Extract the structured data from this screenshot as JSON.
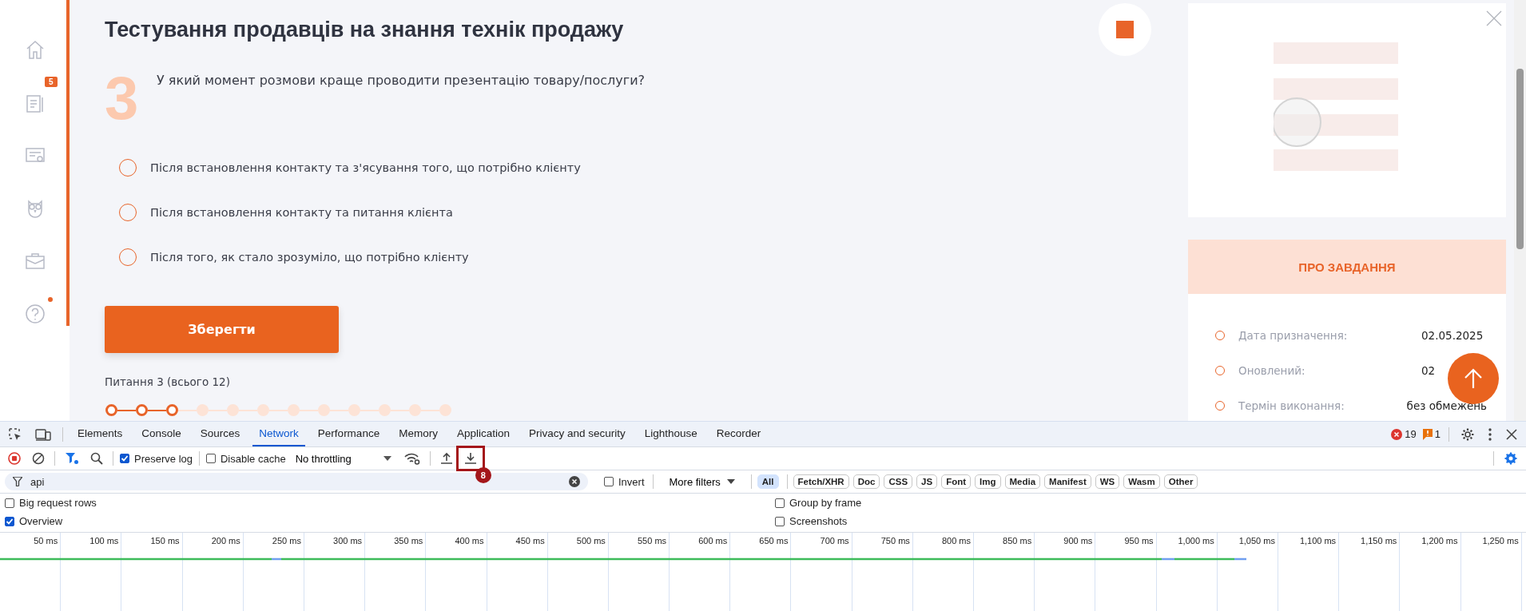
{
  "sidebar": {
    "items": [
      {
        "kind": "home"
      },
      {
        "kind": "document",
        "badge": "5"
      },
      {
        "kind": "certificate"
      },
      {
        "kind": "owl"
      },
      {
        "kind": "briefcase"
      },
      {
        "kind": "help",
        "dot": true
      }
    ]
  },
  "test": {
    "title": "Тестування продавців на знання технік продажу",
    "question_number": "3",
    "question": "У який момент розмови краще проводити презентацію товару/послуги?",
    "options": [
      {
        "text": "Після встановлення контакту та з'ясування того, що потрібно клієнту",
        "selected": false
      },
      {
        "text": "Після встановлення контакту та питання клієнта",
        "selected": false
      },
      {
        "text": "Після того, як стало зрозуміло, що потрібно клієнту",
        "selected": false
      }
    ],
    "save_button": "Зберегти",
    "progress_text": "Питання 3 (всього 12)",
    "progress_steps": [
      {
        "done": true
      },
      {
        "done": true
      },
      {
        "done": true
      },
      {
        "done": false
      },
      {
        "done": false
      },
      {
        "done": false
      },
      {
        "done": false
      },
      {
        "done": false
      },
      {
        "done": false
      },
      {
        "done": false
      },
      {
        "done": false
      },
      {
        "done": false
      }
    ]
  },
  "task_panel": {
    "header": "ПРО ЗАВДАННЯ",
    "details": [
      {
        "label": "Дата призначення:",
        "value": "02.05.2025"
      },
      {
        "label": "Оновлений:",
        "value": "02"
      },
      {
        "label": "Термін виконання:",
        "value": "без обмежень"
      }
    ]
  },
  "devtools": {
    "tabs": [
      {
        "label": "Elements",
        "selected": false
      },
      {
        "label": "Console",
        "selected": false
      },
      {
        "label": "Sources",
        "selected": false
      },
      {
        "label": "Network",
        "selected": true
      },
      {
        "label": "Performance",
        "selected": false
      },
      {
        "label": "Memory",
        "selected": false
      },
      {
        "label": "Application",
        "selected": false
      },
      {
        "label": "Privacy and security",
        "selected": false
      },
      {
        "label": "Lighthouse",
        "selected": false
      },
      {
        "label": "Recorder",
        "selected": false
      }
    ],
    "errors": "19",
    "warnings": "1",
    "toolbar": {
      "preserve_log": {
        "label": "Preserve log",
        "checked": true
      },
      "disable_cache": {
        "label": "Disable cache",
        "checked": false
      },
      "throttling": "No throttling",
      "annotation": "8"
    },
    "filter": {
      "value": "api",
      "invert": {
        "label": "Invert",
        "checked": false
      },
      "more_filters": "More filters",
      "types": [
        {
          "label": "All",
          "selected": true
        },
        {
          "label": "Fetch/XHR",
          "selected": false
        },
        {
          "label": "Doc",
          "selected": false
        },
        {
          "label": "CSS",
          "selected": false
        },
        {
          "label": "JS",
          "selected": false
        },
        {
          "label": "Font",
          "selected": false
        },
        {
          "label": "Img",
          "selected": false
        },
        {
          "label": "Media",
          "selected": false
        },
        {
          "label": "Manifest",
          "selected": false
        },
        {
          "label": "WS",
          "selected": false
        },
        {
          "label": "Wasm",
          "selected": false
        },
        {
          "label": "Other",
          "selected": false
        }
      ]
    },
    "options": [
      {
        "label": "Big request rows",
        "checked": false
      },
      {
        "label": "Group by frame",
        "checked": false
      },
      {
        "label": "Overview",
        "checked": true
      },
      {
        "label": "Screenshots",
        "checked": false
      }
    ],
    "timeline": {
      "ticks": [
        "50 ms",
        "100 ms",
        "150 ms",
        "200 ms",
        "250 ms",
        "300 ms",
        "350 ms",
        "400 ms",
        "450 ms",
        "500 ms",
        "550 ms",
        "600 ms",
        "650 ms",
        "700 ms",
        "750 ms",
        "800 ms",
        "850 ms",
        "900 ms",
        "950 ms",
        "1,000 ms",
        "1,050 ms",
        "1,100 ms",
        "1,150 ms",
        "1,200 ms",
        "1,250 ms"
      ]
    }
  }
}
